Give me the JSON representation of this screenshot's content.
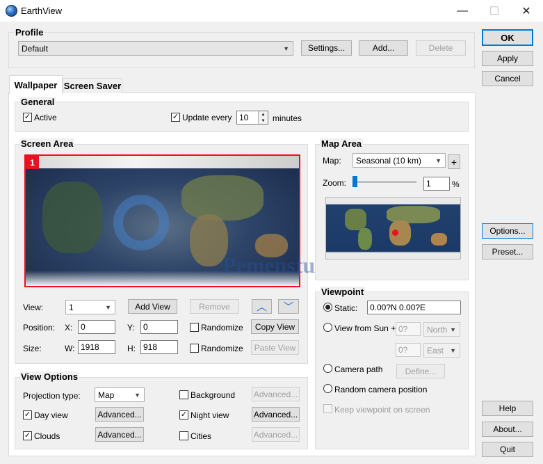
{
  "window": {
    "title": "EarthView",
    "minimize": "—",
    "maximize": "☐",
    "close": "✕"
  },
  "profile": {
    "title": "Profile",
    "selected": "Default",
    "settings_btn": "Settings...",
    "add_btn": "Add...",
    "delete_btn": "Delete"
  },
  "side_buttons": {
    "ok": "OK",
    "apply": "Apply",
    "cancel": "Cancel",
    "options": "Options...",
    "preset": "Preset...",
    "help": "Help",
    "about": "About...",
    "quit": "Quit"
  },
  "tabs": [
    {
      "label": "Wallpaper",
      "active": true
    },
    {
      "label": "Screen Saver",
      "active": false
    }
  ],
  "general": {
    "title": "General",
    "active_label": "Active",
    "active_checked": true,
    "update_label": "Update every",
    "update_checked": true,
    "update_value": "10",
    "minutes_label": "minutes"
  },
  "screen_area": {
    "title": "Screen Area",
    "screen_number": "1",
    "watermark_text": "Pemenstudio.com",
    "view_label": "View:",
    "view_value": "1",
    "add_view_btn": "Add View",
    "remove_btn": "Remove",
    "position_label": "Position:",
    "x_label": "X:",
    "x_value": "0",
    "y_label": "Y:",
    "y_value": "0",
    "randomize_pos": "Randomize",
    "copy_view_btn": "Copy View",
    "size_label": "Size:",
    "w_label": "W:",
    "w_value": "1918",
    "h_label": "H:",
    "h_value": "918",
    "randomize_size": "Randomize",
    "paste_view_btn": "Paste View"
  },
  "map_area": {
    "title": "Map Area",
    "map_label": "Map:",
    "map_value": "Seasonal (10 km)",
    "plus_btn": "+",
    "zoom_label": "Zoom:",
    "zoom_value": "1",
    "zoom_unit": "%"
  },
  "viewpoint": {
    "title": "Viewpoint",
    "static_label": "Static:",
    "static_value": "0.00?N  0.00?E",
    "sun_label": "View from Sun +",
    "sun_lat": "0?",
    "sun_lat_dir": "North",
    "sun_lon": "0?",
    "sun_lon_dir": "East",
    "camera_label": "Camera path",
    "define_btn": "Define...",
    "random_label": "Random camera position",
    "keep_label": "Keep viewpoint on screen"
  },
  "view_options": {
    "title": "View Options",
    "projection_label": "Projection type:",
    "projection_value": "Map",
    "day_view": "Day view",
    "clouds": "Clouds",
    "background": "Background",
    "night_view": "Night view",
    "cities": "Cities",
    "advanced": "Advanced..."
  },
  "colors": {
    "accent": "#0078d7",
    "screen_border": "#e81123",
    "arrow_blue": "#2d6fd0"
  }
}
